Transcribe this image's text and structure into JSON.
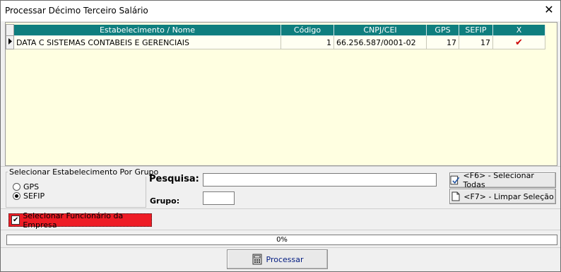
{
  "window": {
    "title": "Processar Décimo Terceiro Salário",
    "close_glyph": "✕"
  },
  "grid": {
    "columns": [
      "Estabelecimento / Nome",
      "Código",
      "CNPJ/CEI",
      "GPS",
      "SEFIP",
      "X"
    ],
    "rows": [
      {
        "nome": "DATA C SISTEMAS CONTABEIS E GERENCIAIS",
        "codigo": "1",
        "cnpj": "66.256.587/0001-02",
        "gps": "17",
        "sefip": "17",
        "x": "✔"
      }
    ]
  },
  "group": {
    "legend": "Selecionar Estabelecimento Por Grupo",
    "options": [
      {
        "label": "GPS",
        "selected": false
      },
      {
        "label": "SEFIP",
        "selected": true
      }
    ]
  },
  "search": {
    "label": "Pesquisa:",
    "value": ""
  },
  "grupo": {
    "label": "Grupo:",
    "value": ""
  },
  "buttons": {
    "select_all": "<F6> - Selecionar Todas",
    "clear": "<F7> - Limpar Seleção",
    "process": "Processar"
  },
  "employee_checkbox": {
    "label": "Selecionar Funcionário da Empresa",
    "checked": true
  },
  "progress": {
    "text": "0%",
    "value": 0
  },
  "colors": {
    "header": "#0f7e7e",
    "grid_bg": "#ffffe1",
    "check": "#cc0000",
    "highlight": "#ee1c25"
  }
}
